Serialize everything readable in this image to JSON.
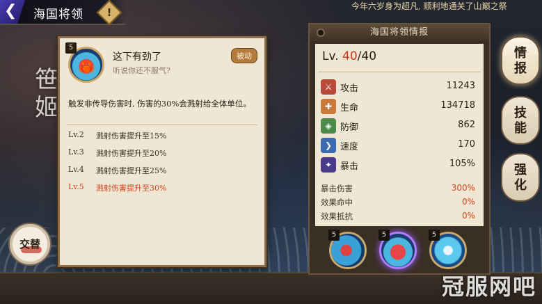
{
  "header": {
    "title": "海国将领",
    "info_icon": "exclamation-icon"
  },
  "background": {
    "vertical_chars": "笹\n姬",
    "top_text": "今年六岁身为超凡, 顺利地通关了山巅之祭"
  },
  "skill_detail": {
    "level": "5",
    "name": "这下有劲了",
    "quote": "听说你还不服气?",
    "type_tag": "被动",
    "description": "触发非传导伤害时, 伤害的30%会溅射给全体单位。",
    "upgrades": [
      {
        "level": "Lv.2",
        "text": "溅射伤害提升至15%",
        "active": false
      },
      {
        "level": "Lv.3",
        "text": "溅射伤害提升至20%",
        "active": false
      },
      {
        "level": "Lv.4",
        "text": "溅射伤害提升至25%",
        "active": false
      },
      {
        "level": "Lv.5",
        "text": "溅射伤害提升至30%",
        "active": true
      }
    ]
  },
  "stats_panel": {
    "title": "海国将领情报",
    "level_prefix": "Lv. ",
    "level_current": "40",
    "level_max": "/40",
    "stats": [
      {
        "icon": "attack-icon",
        "name": "攻击",
        "value": "11243"
      },
      {
        "icon": "hp-icon",
        "name": "生命",
        "value": "134718"
      },
      {
        "icon": "defense-icon",
        "name": "防御",
        "value": "862"
      },
      {
        "icon": "speed-icon",
        "name": "速度",
        "value": "170"
      },
      {
        "icon": "crit-icon",
        "name": "暴击",
        "value": "105%"
      }
    ],
    "extra_stats": [
      {
        "name": "暴击伤害",
        "value": "300%"
      },
      {
        "name": "效果命中",
        "value": "0%"
      },
      {
        "name": "效果抵抗",
        "value": "0%"
      }
    ],
    "skills": [
      {
        "level": "5",
        "icon": "skill-1-icon"
      },
      {
        "level": "5",
        "icon": "skill-crab-icon"
      },
      {
        "level": "5",
        "icon": "skill-3-icon"
      }
    ]
  },
  "tabs": [
    {
      "label": "情\n报",
      "active": true
    },
    {
      "label": "技\n能",
      "active": false
    },
    {
      "label": "强\n化",
      "active": false
    }
  ],
  "replace_button": "交替",
  "watermark": "冠服网吧",
  "colors": {
    "accent_red": "#d0441e",
    "panel_bg": "#efe6d4",
    "frame": "#3a2f25"
  }
}
